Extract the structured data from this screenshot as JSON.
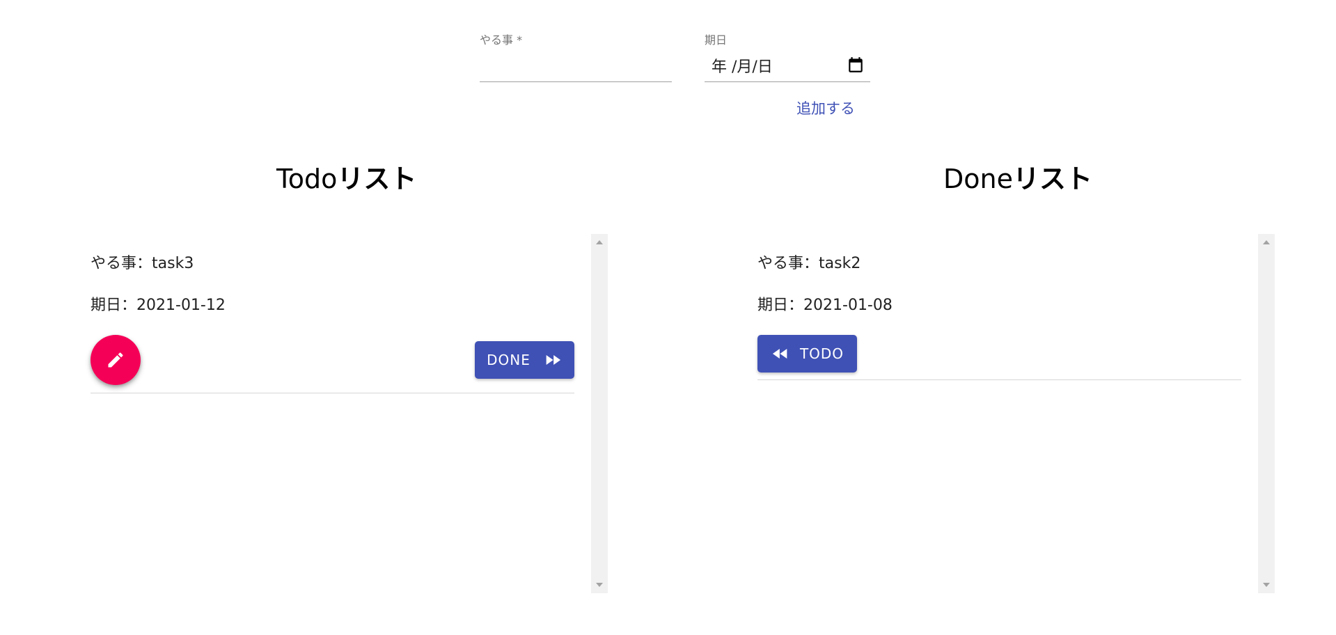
{
  "form": {
    "task_label": "やる事 *",
    "task_value": "",
    "date_label": "期日",
    "date_value": "年 /月/日",
    "add_button_label": "追加する"
  },
  "todo": {
    "title_prefix": "Todo",
    "title_suffix": "リスト",
    "items": [
      {
        "task_label": "やる事：",
        "task": "task3",
        "date_label": "期日：",
        "date": "2021-01-12",
        "action_label": "DONE",
        "action_icon": "fast-forward-icon",
        "edit_icon": "pencil-icon"
      }
    ]
  },
  "done": {
    "title_prefix": "Done",
    "title_suffix": "リスト",
    "items": [
      {
        "task_label": "やる事：",
        "task": "task2",
        "date_label": "期日：",
        "date": "2021-01-08",
        "action_label": "TODO",
        "action_icon": "rewind-icon"
      }
    ]
  },
  "colors": {
    "primary": "#3f51b5",
    "secondary": "#f50057",
    "divider": "#d6d6d6",
    "label": "#757575"
  }
}
